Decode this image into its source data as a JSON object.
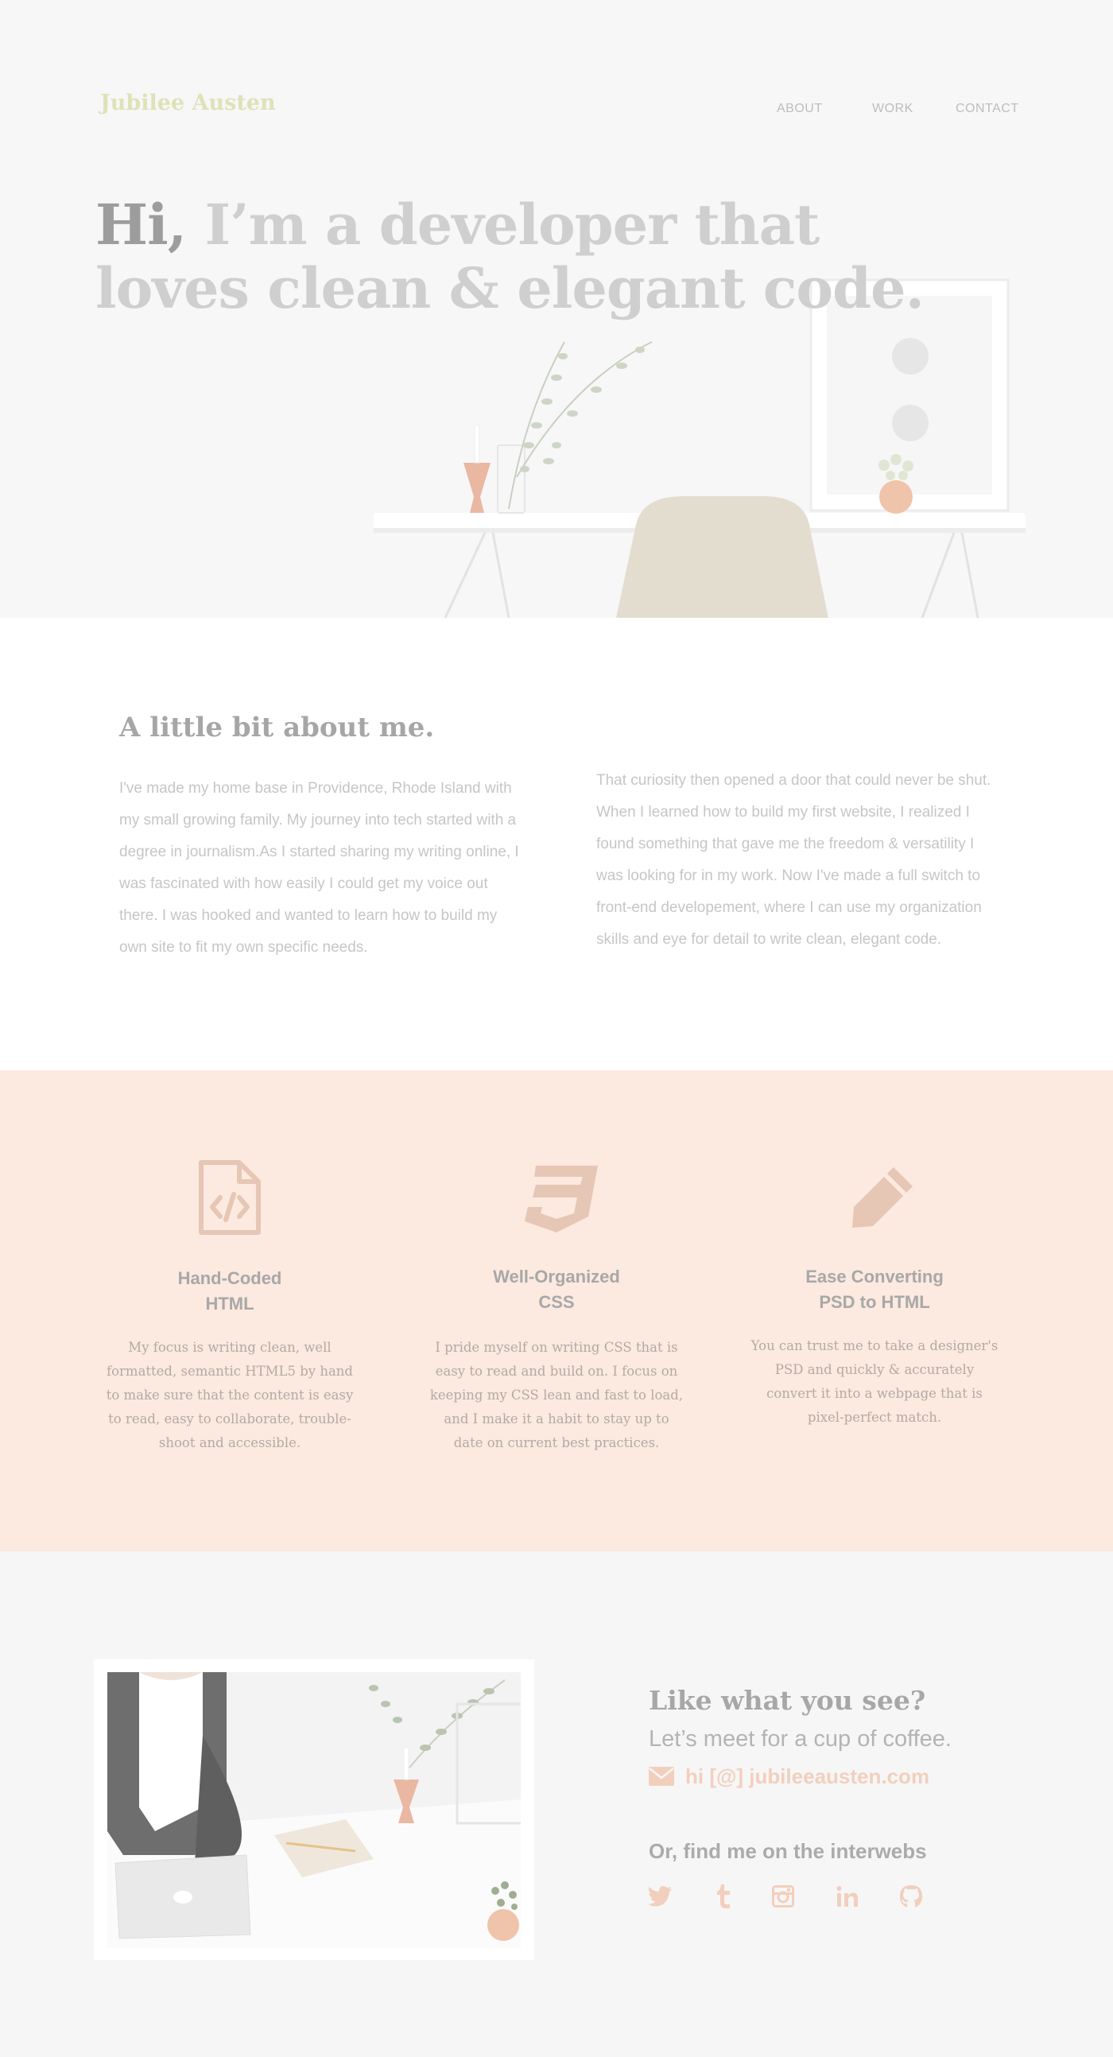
{
  "brand": {
    "name": "Jubilee Austen"
  },
  "nav": {
    "about": "ABOUT",
    "work": "WORK",
    "contact": "CONTACT"
  },
  "hero": {
    "hi": "Hi,",
    "rest": " I’m a developer that loves clean & elegant code."
  },
  "about": {
    "title": "A little bit about me.",
    "p1": "I've made my home base in Providence, Rhode Island with my small growing family. My journey into tech started with a degree in journalism.As I started sharing my writing online, I was fascinated with how easily I could get my voice out there. I was hooked and wanted to learn how to build my own site to fit my own specific needs.",
    "p2": "That curiosity then opened a door that could never be shut. When I learned how to build my first website, I realized I found something that gave me the freedom & versatility I was looking for in my work. Now I've made a full switch to front-end developement, where I can use my organization skills and eye for detail to write clean, elegant code."
  },
  "services": [
    {
      "icon": "html-file-icon",
      "title_line1": "Hand-Coded",
      "title_line2": "HTML",
      "desc": "My focus is writing clean, well formatted, semantic HTML5 by hand to make sure that the content is easy to read, easy to collaborate, trouble-shoot and accessible."
    },
    {
      "icon": "css3-icon",
      "title_line1": "Well-Organized",
      "title_line2": "CSS",
      "desc": "I pride myself on writing CSS that is easy to read and build on. I focus on keeping my CSS lean and fast to load, and I make it a habit to stay up to date on current best practices."
    },
    {
      "icon": "pencil-icon",
      "title_line1": "Ease Converting",
      "title_line2": "PSD to HTML",
      "desc": "You can trust me to take a designer's PSD and quickly & accurately convert it into a webpage that is pixel-perfect match."
    }
  ],
  "contact": {
    "title": "Like what you see?",
    "subtitle": "Let’s meet for a cup of coffee.",
    "email": "hi [@] jubileeausten.com",
    "find_title": "Or, find me on the interwebs",
    "social": [
      "twitter-icon",
      "tumblr-icon",
      "instagram-icon",
      "linkedin-icon",
      "github-icon"
    ]
  },
  "colors": {
    "accent_peach": "#fce9df",
    "brand_green": "#dfe2b8",
    "icon_pink": "#f2cfbd"
  }
}
